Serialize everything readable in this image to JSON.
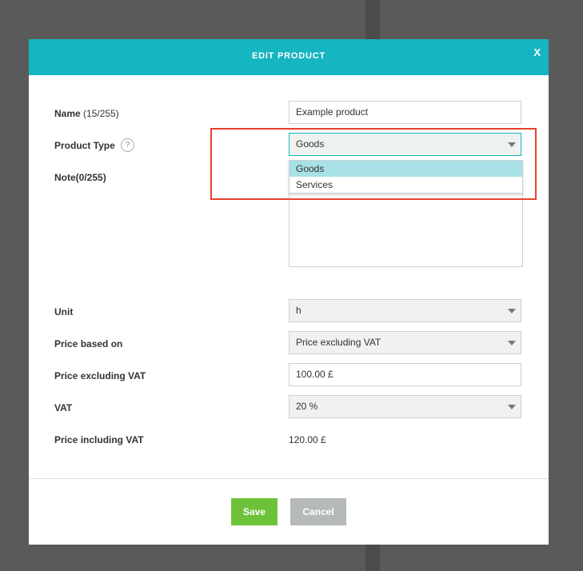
{
  "modal": {
    "title": "EDIT PRODUCT",
    "close_label": "X"
  },
  "form": {
    "name": {
      "label": "Name",
      "count": "(15/255)",
      "value": "Example product"
    },
    "product_type": {
      "label": "Product Type",
      "help": "?",
      "value": "Goods",
      "options": [
        "Goods",
        "Services"
      ],
      "selected_option": "Goods"
    },
    "note": {
      "label": "Note(0/255)",
      "value": ""
    },
    "unit": {
      "label": "Unit",
      "value": "h"
    },
    "price_based_on": {
      "label": "Price based on",
      "value": "Price excluding VAT"
    },
    "price_excl_vat": {
      "label": "Price excluding VAT",
      "value": "100.00 £"
    },
    "vat": {
      "label": "VAT",
      "value": "20 %"
    },
    "price_incl_vat": {
      "label": "Price including VAT",
      "value": "120.00 £"
    }
  },
  "buttons": {
    "save": "Save",
    "cancel": "Cancel"
  },
  "colors": {
    "header": "#16b5c2",
    "save": "#6dc23a",
    "cancel": "#b6bab7",
    "highlight_box": "#e8422c",
    "dropdown_selected": "#a7e1e6"
  },
  "icons": {
    "close": "close-icon",
    "help": "help-icon",
    "dropdown": "chevron-down-icon"
  }
}
